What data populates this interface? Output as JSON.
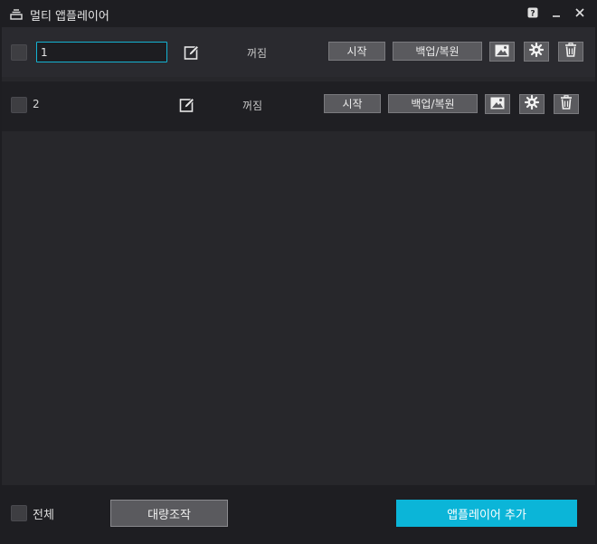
{
  "window": {
    "title": "멀티 앱플레이어",
    "icons": {
      "app": "stack-icon",
      "help": "help-icon",
      "minimize": "minimize-icon",
      "close": "close-icon"
    }
  },
  "instances": [
    {
      "name": "1",
      "status": "꺼짐",
      "start_label": "시작",
      "backup_label": "백업/복원",
      "editing": true
    },
    {
      "name": "2",
      "status": "꺼짐",
      "start_label": "시작",
      "backup_label": "백업/복원",
      "editing": false
    }
  ],
  "row_icons": {
    "edit": "edit-icon",
    "shortcut": "image-icon",
    "settings": "gear-icon",
    "delete": "trash-icon"
  },
  "footer": {
    "select_all_label": "전체",
    "batch_label": "대량조작",
    "add_label": "앱플레이어 추가"
  },
  "colors": {
    "accent": "#0bb5d8",
    "background": "#1e1e22",
    "button": "#5a5a5e"
  }
}
